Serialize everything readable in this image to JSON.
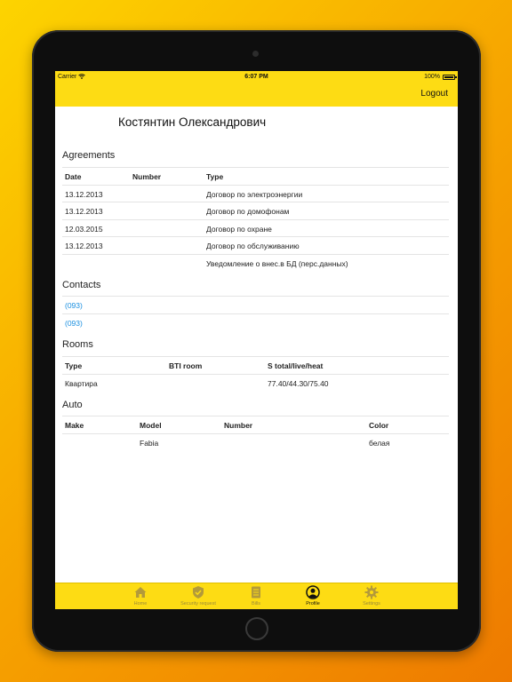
{
  "status_bar": {
    "carrier": "Carrier",
    "time": "6:07 PM",
    "battery": "100%"
  },
  "nav": {
    "logout": "Logout"
  },
  "profile": {
    "name": "Костянтин Олександрович"
  },
  "agreements": {
    "title": "Agreements",
    "headers": [
      "Date",
      "Number",
      "Type"
    ],
    "rows": [
      [
        "13.12.2013",
        "",
        "Договор по электроэнергии"
      ],
      [
        "13.12.2013",
        "",
        "Договор по домофонам"
      ],
      [
        "12.03.2015",
        "",
        "Договор по охране"
      ],
      [
        "13.12.2013",
        "",
        "Договор по обслуживанию"
      ],
      [
        "",
        "",
        "Уведомление о внес.в БД (перс.данных)"
      ]
    ]
  },
  "contacts": {
    "title": "Contacts",
    "items": [
      "(093)",
      "(093)"
    ]
  },
  "rooms": {
    "title": "Rooms",
    "headers": [
      "Type",
      "BTI room",
      "S total/live/heat"
    ],
    "rows": [
      [
        "Квартира",
        "",
        "77.40/44.30/75.40"
      ]
    ]
  },
  "auto": {
    "title": "Auto",
    "headers": [
      "Make",
      "Model",
      "Number",
      "Color"
    ],
    "rows": [
      [
        "",
        "Fabia",
        "",
        "белая"
      ]
    ]
  },
  "tabbar": {
    "items": [
      {
        "label": "Home",
        "icon": "home-icon"
      },
      {
        "label": "Security request",
        "icon": "shield-icon"
      },
      {
        "label": "Bills",
        "icon": "document-icon"
      },
      {
        "label": "Profile",
        "icon": "profile-icon"
      },
      {
        "label": "Settings",
        "icon": "gear-icon"
      }
    ],
    "active": "Profile"
  },
  "colors": {
    "accent": "#fddc14",
    "link": "#1a8fe0",
    "text": "#222222"
  }
}
